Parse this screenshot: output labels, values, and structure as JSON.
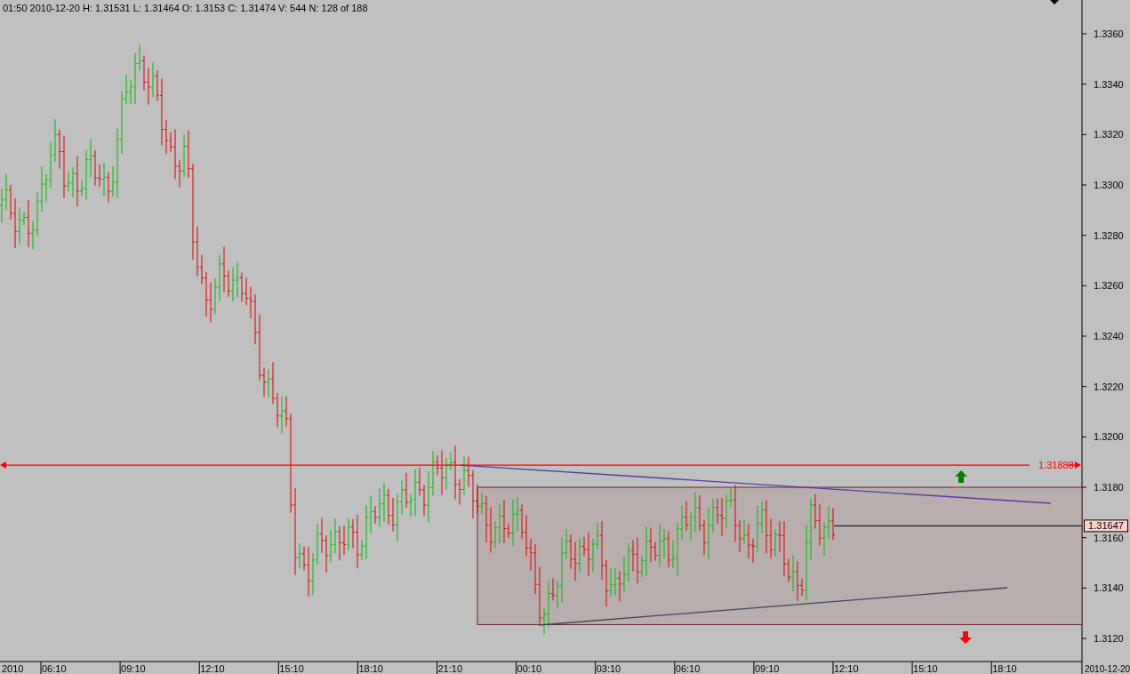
{
  "header": "01:50 2010-12-20 H: 1.31531 L: 1.31464 O: 1.3153 C: 1.31474 V: 544 N: 128 of 188",
  "price_axis": {
    "labels": [
      "1.3360",
      "1.3340",
      "1.3320",
      "1.3300",
      "1.3280",
      "1.3260",
      "1.3240",
      "1.3220",
      "1.3200",
      "1.3180",
      "1.3160",
      "1.3140",
      "1.3120"
    ]
  },
  "time_axis": {
    "labels": [
      "2010",
      "06:10",
      "09:10",
      "12:10",
      "15:10",
      "18:10",
      "21:10",
      "00:10",
      "03:10",
      "06:10",
      "09:10",
      "12:10",
      "15:10",
      "18:10"
    ],
    "date": "2010-12-20"
  },
  "level_line": {
    "label": "1.31888"
  },
  "last_price": {
    "label": "1.31647"
  }
}
